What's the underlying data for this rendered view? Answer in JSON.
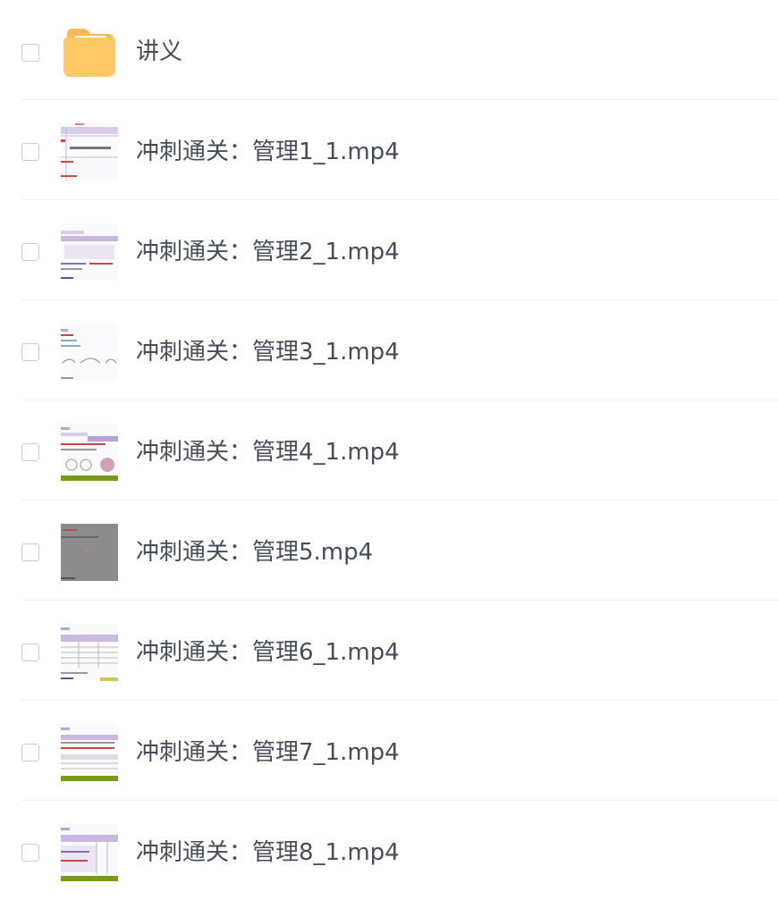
{
  "files": [
    {
      "name": "讲义",
      "type": "folder",
      "icon": "folder-icon"
    },
    {
      "name": "冲刺通关：管理1_1.mp4",
      "type": "video",
      "icon": "video-thumbnail-doc"
    },
    {
      "name": "冲刺通关：管理2_1.mp4",
      "type": "video",
      "icon": "video-thumbnail-doc"
    },
    {
      "name": "冲刺通关：管理3_1.mp4",
      "type": "video",
      "icon": "video-thumbnail-doc"
    },
    {
      "name": "冲刺通关：管理4_1.mp4",
      "type": "video",
      "icon": "video-thumbnail-doc"
    },
    {
      "name": "冲刺通关：管理5.mp4",
      "type": "video",
      "icon": "video-thumbnail-gray"
    },
    {
      "name": "冲刺通关：管理6_1.mp4",
      "type": "video",
      "icon": "video-thumbnail-doc"
    },
    {
      "name": "冲刺通关：管理7_1.mp4",
      "type": "video",
      "icon": "video-thumbnail-doc"
    },
    {
      "name": "冲刺通关：管理8_1.mp4",
      "type": "video",
      "icon": "video-thumbnail-doc"
    }
  ],
  "colors": {
    "folder": "#ffc966",
    "folder_tab": "#ffb84d",
    "text": "#454d5a",
    "divider": "#f0f0f2",
    "checkbox_border": "#c9ccd3",
    "thumb_header": "#b9a3d6",
    "thumb_bar": "#7a9a1a",
    "thumb_gray": "#8c8c8c"
  }
}
